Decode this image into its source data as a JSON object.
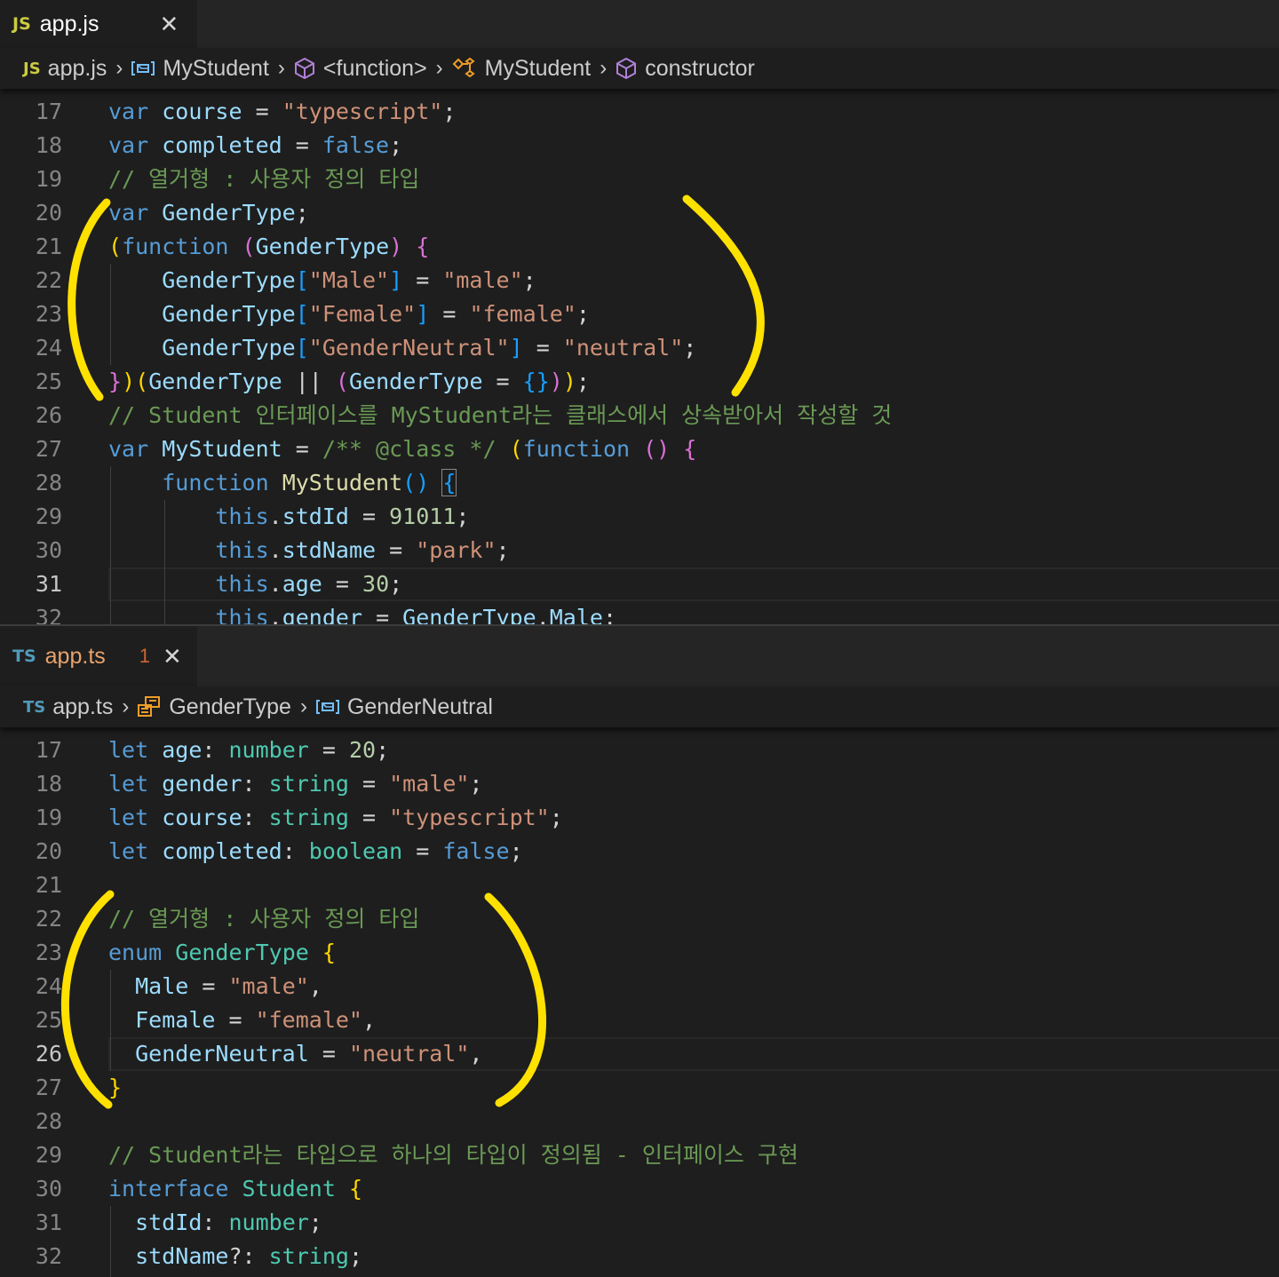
{
  "top_editor": {
    "tab": {
      "badge": "JS",
      "name": "app.js",
      "close": "✕"
    },
    "breadcrumb": [
      "app.js",
      "MyStudent",
      "<function>",
      "MyStudent",
      "constructor"
    ],
    "line_numbers": [
      "17",
      "18",
      "19",
      "20",
      "21",
      "22",
      "23",
      "24",
      "25",
      "26",
      "27",
      "28",
      "29",
      "30",
      "31",
      "32"
    ],
    "active_line": "31"
  },
  "bottom_editor": {
    "tab": {
      "badge": "TS",
      "name": "app.ts",
      "problem_count": "1",
      "close": "✕"
    },
    "breadcrumb": [
      "app.ts",
      "GenderType",
      "GenderNeutral"
    ],
    "line_numbers": [
      "17",
      "18",
      "19",
      "20",
      "21",
      "22",
      "23",
      "24",
      "25",
      "26",
      "27",
      "28",
      "29",
      "30",
      "31",
      "32"
    ],
    "active_line": "26"
  },
  "code_text": {
    "js": {
      "course_str": "\"typescript\"",
      "comment_enum": "// 열거형 : 사용자 정의 타입",
      "male_key": "\"Male\"",
      "male_val": "\"male\"",
      "female_key": "\"Female\"",
      "female_val": "\"female\"",
      "neutral_key": "\"GenderNeutral\"",
      "neutral_val": "\"neutral\"",
      "comment_student": "// Student 인터페이스를 MyStudent라는 클래스에서 상속받아서 작성할 것",
      "class_comment": "/** @class */",
      "std_id": "91011",
      "std_name": "\"park\"",
      "age": "30"
    },
    "ts": {
      "age": "20",
      "gender_str": "\"male\"",
      "course_str": "\"typescript\"",
      "comment_enum": "// 열거형 : 사용자 정의 타입",
      "male_val": "\"male\"",
      "female_val": "\"female\"",
      "neutral_val": "\"neutral\"",
      "comment_student": "// Student라는 타입으로 하나의 타입이 정의됨 - 인터페이스 구현"
    }
  },
  "colors": {
    "editor_bg": "#1e1e1e",
    "keyword": "#569cd6",
    "variable": "#9cdcfe",
    "string": "#ce9178",
    "number": "#b5cea8",
    "comment": "#6a9955",
    "type": "#4ec9b0",
    "function": "#dcdcaa",
    "annotation": "#ffe100"
  }
}
